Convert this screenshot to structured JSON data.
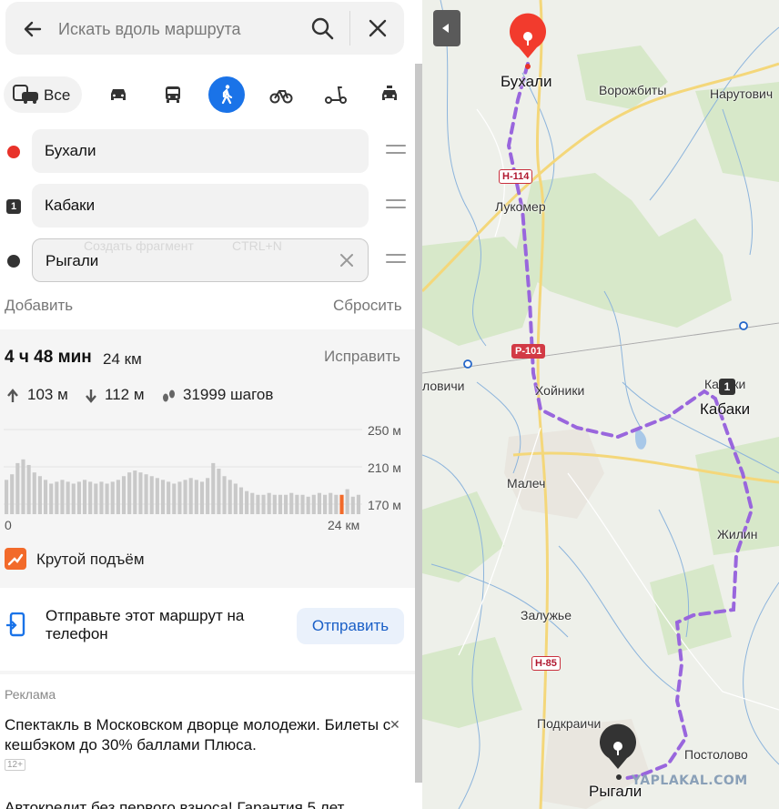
{
  "search": {
    "placeholder": "Искать вдоль маршрута"
  },
  "modes": {
    "all_label": "Все"
  },
  "waypoints": [
    {
      "name": "Бухали",
      "marker": "red-dot"
    },
    {
      "name": "Кабаки",
      "marker": "number-1"
    },
    {
      "name": "Рыгали",
      "marker": "dark-dot"
    }
  ],
  "marker_number": "1",
  "ghost_tooltip": {
    "label": "Создать фрагмент",
    "shortcut": "CTRL+N"
  },
  "actions": {
    "add": "Добавить",
    "reset": "Сбросить"
  },
  "route": {
    "duration": "4 ч 48 мин",
    "distance": "24 км",
    "fix": "Исправить",
    "ascent": "103 м",
    "descent": "112 м",
    "steps": "31999 шагов"
  },
  "chart_data": {
    "type": "bar",
    "yticks": [
      "250 м",
      "210 м",
      "170 м"
    ],
    "xticks": [
      "0",
      "24 км"
    ],
    "values": [
      196,
      202,
      214,
      218,
      212,
      204,
      200,
      196,
      192,
      194,
      196,
      194,
      192,
      194,
      196,
      194,
      192,
      194,
      192,
      194,
      196,
      200,
      204,
      206,
      204,
      202,
      200,
      198,
      196,
      194,
      192,
      194,
      196,
      198,
      196,
      194,
      198,
      214,
      208,
      200,
      196,
      192,
      188,
      184,
      182,
      180,
      180,
      182,
      180,
      180,
      180,
      182,
      180,
      180,
      178,
      180,
      182,
      180,
      182,
      180,
      180,
      186,
      178,
      180
    ]
  },
  "steep": {
    "label": "Крутой подъём"
  },
  "send": {
    "text": "Отправьте этот маршрут на телефон",
    "button": "Отправить"
  },
  "ads": {
    "label": "Реклама",
    "text1": "Спектакль в Московском дворце молодежи. Билеты с кешбэком до 30% баллами Плюса.",
    "age": "12+",
    "text2": "Автокредит без первого взноса! Гарантия 5 лет"
  },
  "map": {
    "places": {
      "bukhali": "Бухали",
      "vorozhbity": "Ворожбиты",
      "narutovichi": "Нарутович",
      "lukomer": "Лукомер",
      "khoyniki": "Хойники",
      "kabaki_small": "Кабаки",
      "kabaki": "Кабаки",
      "lovichi": "ловичи",
      "malech": "Малеч",
      "zhilin": "Жилин",
      "zaluzhye": "Залужье",
      "podkraichi": "Подкраичи",
      "postolovo": "Постолово",
      "rygali": "Рыгали"
    },
    "roads": {
      "n114": "Н-114",
      "r101": "Р-101",
      "n85": "Н-85"
    },
    "watermark": "YAPLAKAL.COM",
    "route_color": "#9966dd"
  }
}
